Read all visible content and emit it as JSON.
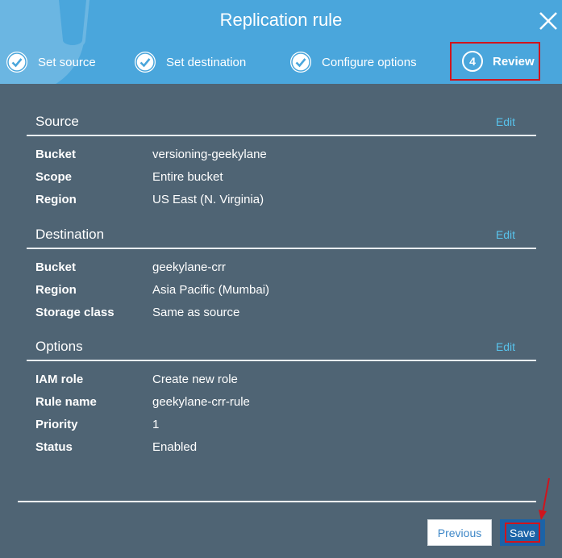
{
  "dialog": {
    "title": "Replication rule"
  },
  "steps": [
    {
      "label": "Set source",
      "state": "complete"
    },
    {
      "label": "Set destination",
      "state": "complete"
    },
    {
      "label": "Configure options",
      "state": "complete"
    },
    {
      "label": "Review",
      "number": "4",
      "state": "active"
    }
  ],
  "sections": {
    "source": {
      "title": "Source",
      "edit": "Edit",
      "rows": [
        {
          "key": "Bucket",
          "value": "versioning-geekylane"
        },
        {
          "key": "Scope",
          "value": "Entire bucket"
        },
        {
          "key": "Region",
          "value": "US East (N. Virginia)"
        }
      ]
    },
    "destination": {
      "title": "Destination",
      "edit": "Edit",
      "rows": [
        {
          "key": "Bucket",
          "value": "geekylane-crr"
        },
        {
          "key": "Region",
          "value": "Asia Pacific (Mumbai)"
        },
        {
          "key": "Storage class",
          "value": "Same as source"
        }
      ]
    },
    "options": {
      "title": "Options",
      "edit": "Edit",
      "rows": [
        {
          "key": "IAM role",
          "value": "Create new role"
        },
        {
          "key": "Rule name",
          "value": "geekylane-crr-rule"
        },
        {
          "key": "Priority",
          "value": "1"
        },
        {
          "key": "Status",
          "value": "Enabled"
        }
      ]
    }
  },
  "footer": {
    "previous_label": "Previous",
    "save_label": "Save"
  },
  "colors": {
    "header": "#4aa6dc",
    "body": "#4f6474",
    "accent_link": "#58c3ec",
    "primary_button": "#1b63a7",
    "highlight": "#d0141c"
  },
  "icons": {
    "close": "close-icon",
    "check": "check-circle-icon",
    "annotation": "red-arrow"
  }
}
